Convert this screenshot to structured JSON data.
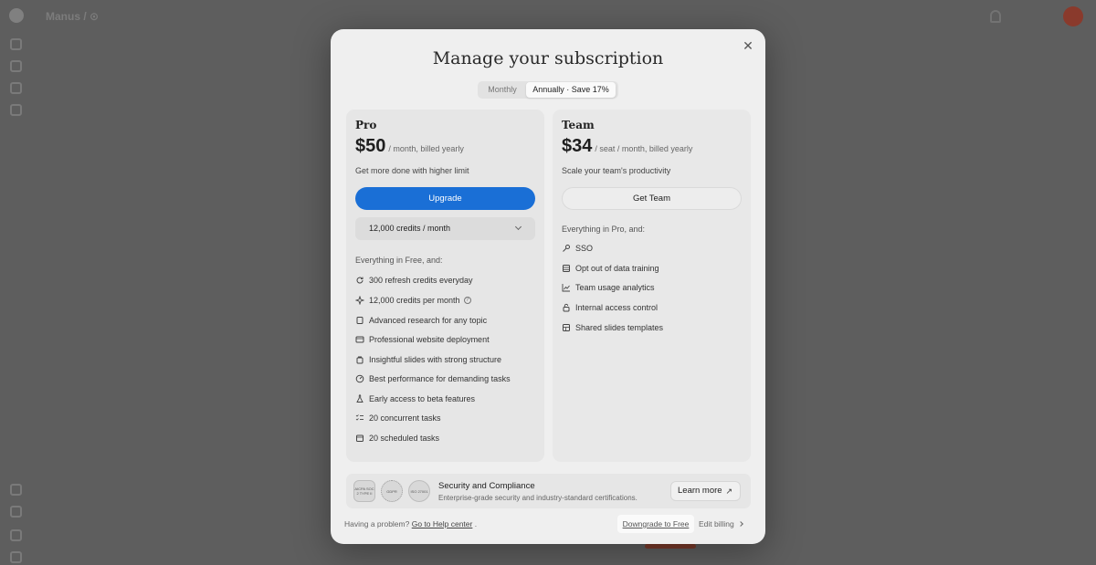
{
  "background": {
    "title": "Manus / ⊙"
  },
  "modal": {
    "title": "Manage your subscription",
    "close_icon": "close-icon"
  },
  "billing_toggle": {
    "monthly_label": "Monthly",
    "annual_label": "Annually · Save 17%",
    "selected": "annual"
  },
  "pro": {
    "name": "Pro",
    "price": "$50",
    "price_note": "/ month, billed yearly",
    "description": "Get more done with higher limit",
    "button_label": "Upgrade",
    "credits_selected": "12,000 credits / month",
    "features_heading": "Everything in Free, and:",
    "features": [
      {
        "label": "300 refresh credits everyday",
        "icon": "refresh-icon"
      },
      {
        "label": "12,000 credits per month",
        "icon": "sparkle-icon"
      },
      {
        "label": "Advanced research for any topic",
        "icon": "book-icon"
      },
      {
        "label": "Professional website deployment",
        "icon": "browser-icon"
      },
      {
        "label": "Insightful slides with strong structure",
        "icon": "slides-icon"
      },
      {
        "label": "Best performance for demanding tasks",
        "icon": "speed-icon"
      },
      {
        "label": "Early access to beta features",
        "icon": "flask-icon"
      },
      {
        "label": "20 concurrent tasks",
        "icon": "list-check-icon"
      },
      {
        "label": "20 scheduled tasks",
        "icon": "calendar-icon"
      }
    ]
  },
  "team": {
    "name": "Team",
    "price": "$34",
    "price_note": "/ seat / month, billed yearly",
    "description": "Scale your team's productivity",
    "button_label": "Get Team",
    "features_heading": "Everything in Pro, and:",
    "features": [
      {
        "label": "SSO",
        "icon": "key-icon"
      },
      {
        "label": "Opt out of data training",
        "icon": "database-icon"
      },
      {
        "label": "Team usage analytics",
        "icon": "chart-icon"
      },
      {
        "label": "Internal access control",
        "icon": "lock-icon"
      },
      {
        "label": "Shared slides templates",
        "icon": "template-icon"
      }
    ]
  },
  "security": {
    "badges": [
      {
        "text": "AICPA SOC 2 TYPE II"
      },
      {
        "text": "GDPR"
      },
      {
        "text": "ISO 27001"
      }
    ],
    "title": "Security and Compliance",
    "subtitle": "Enterprise-grade security and industry-standard certifications.",
    "learn_more": "Learn more"
  },
  "footer": {
    "problem_text": "Having a problem?",
    "help_link": "Go to Help center",
    "after_link": ".",
    "downgrade_label": "Downgrade to Free",
    "edit_billing_label": "Edit billing"
  }
}
